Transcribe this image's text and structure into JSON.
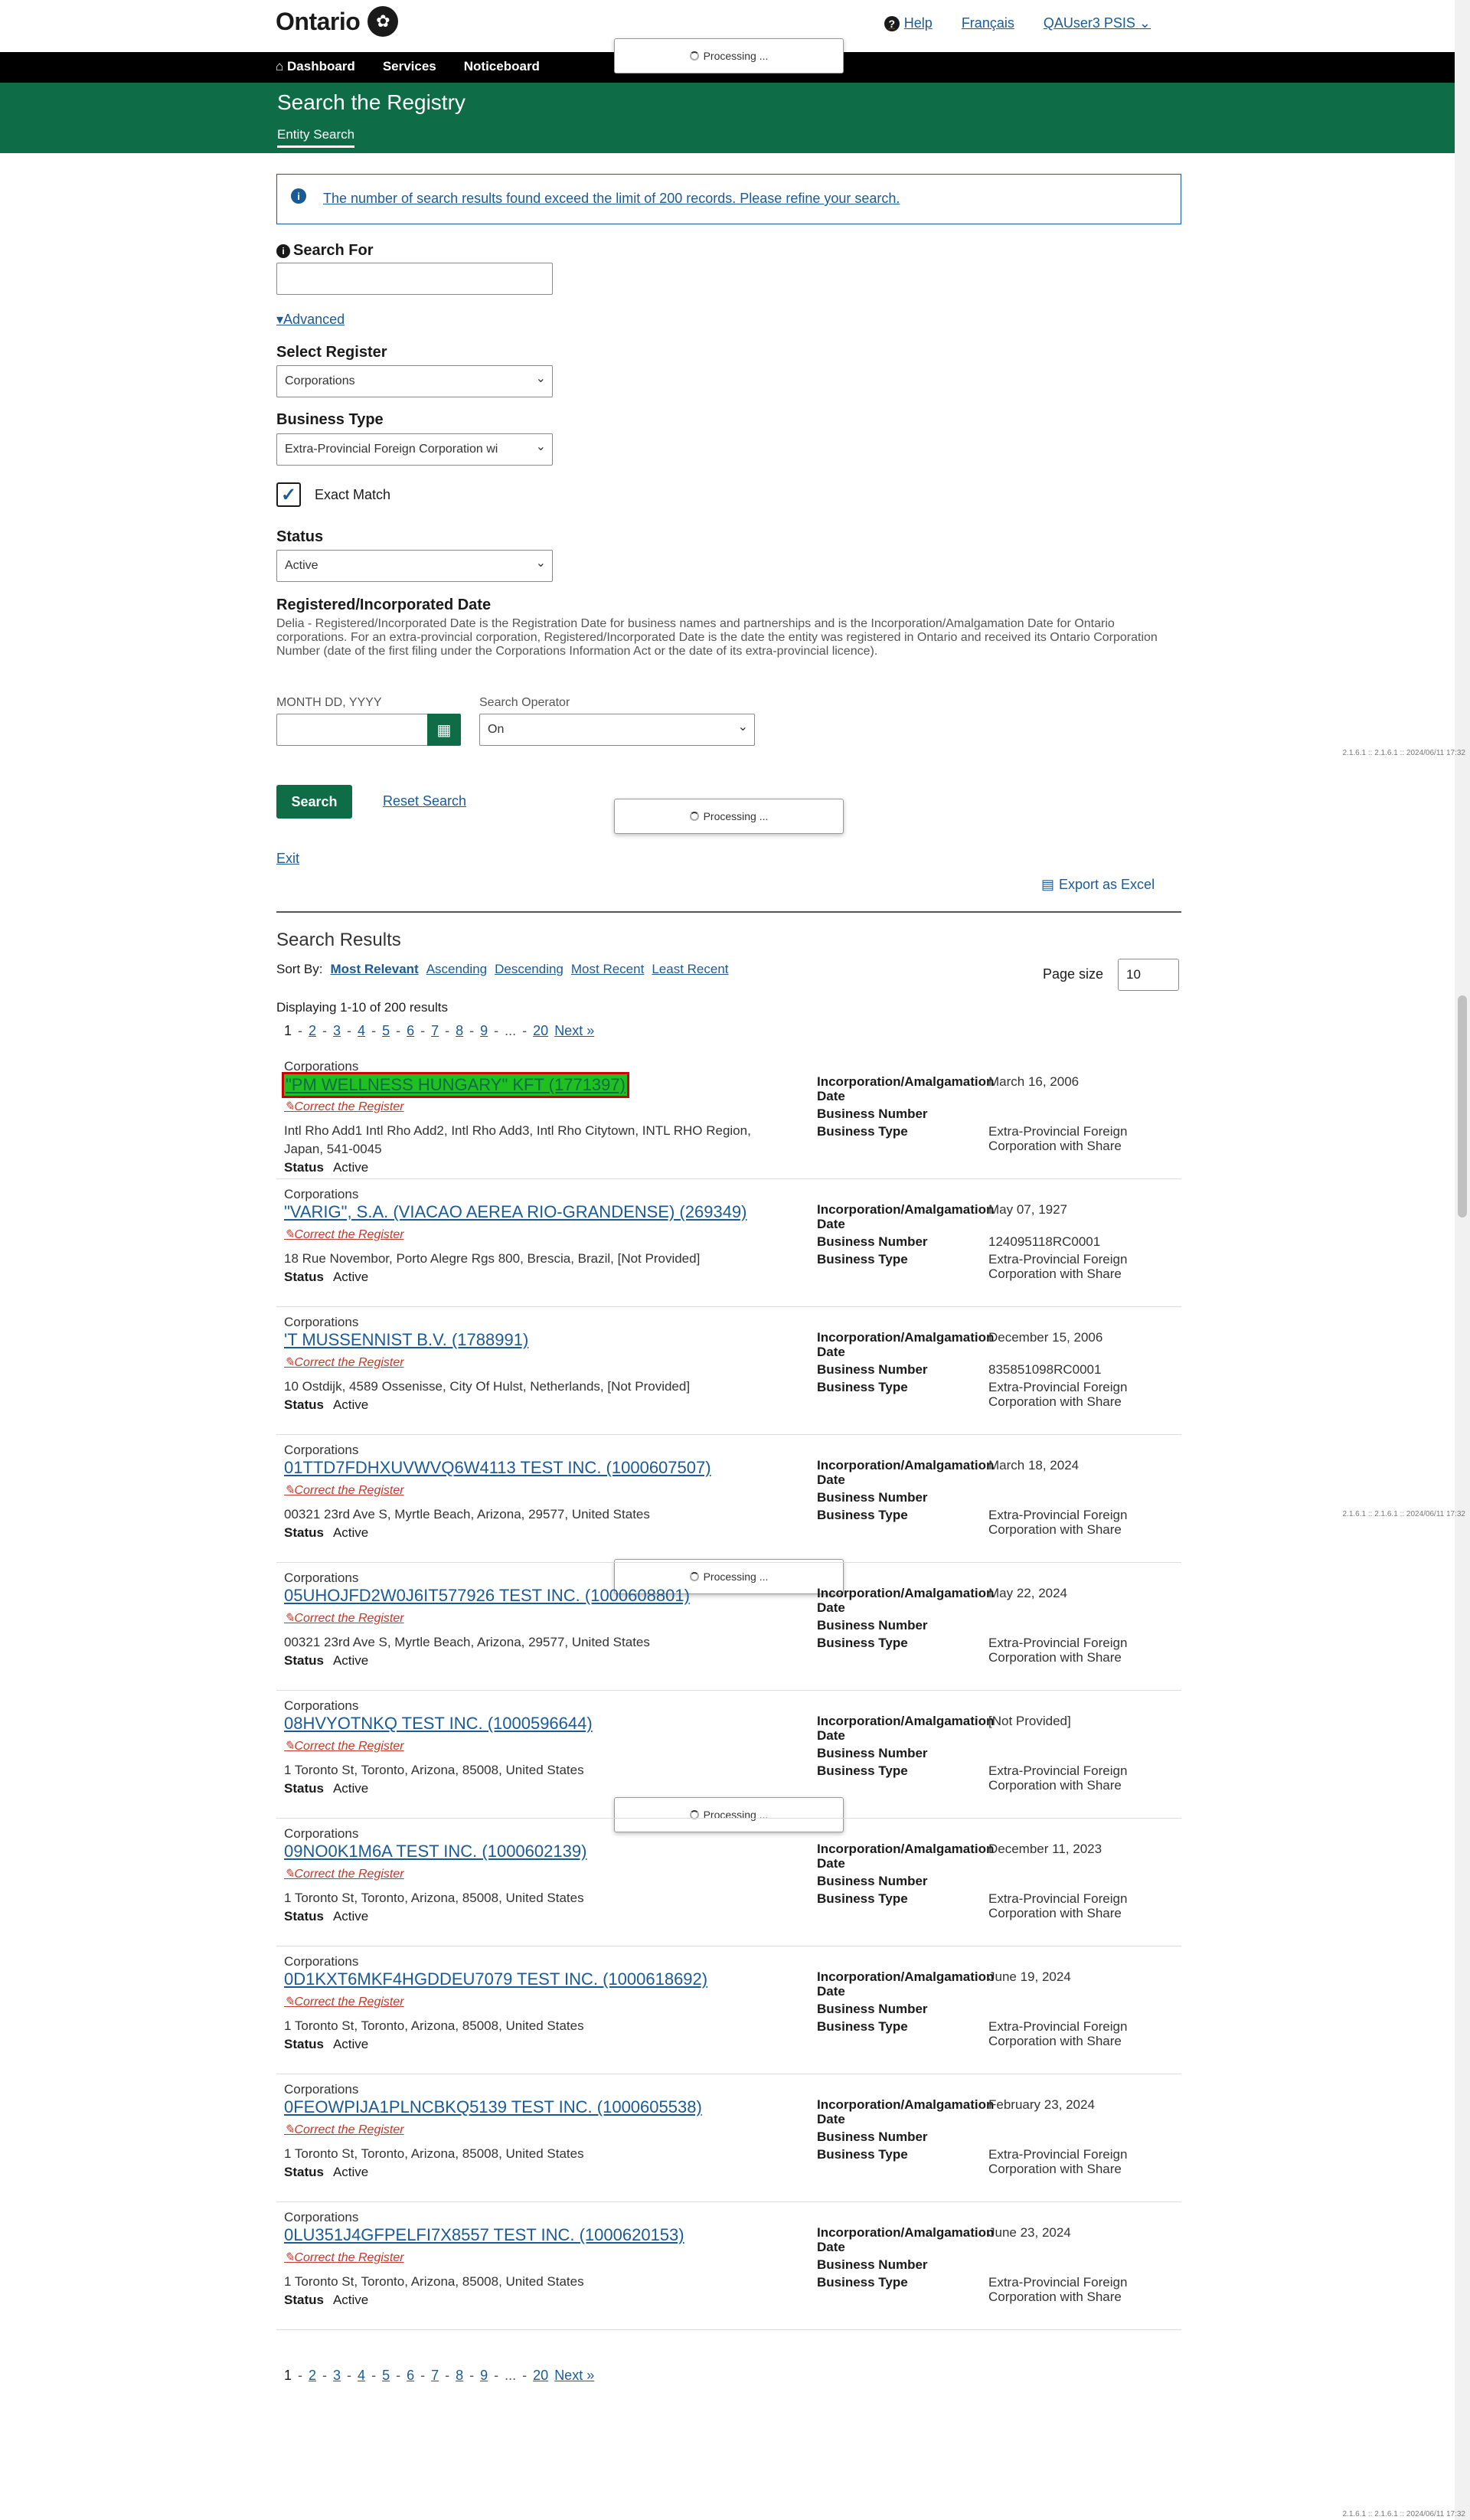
{
  "header": {
    "logo_text": "Ontario",
    "help": "Help",
    "language": "Français",
    "user": "QAUser3 PSIS"
  },
  "nav": {
    "dashboard": "Dashboard",
    "services": "Services",
    "noticeboard": "Noticeboard"
  },
  "page": {
    "title": "Search the Registry",
    "subtab": "Entity Search"
  },
  "processing_text": "Processing ...",
  "version_note": "2.1.6.1 :: 2.1.6.1 :: 2024/06/11 17:32",
  "alert": {
    "message": "The number of search results found exceed the limit of 200 records. Please refine your search."
  },
  "form": {
    "search_for_label": "Search For",
    "search_for_value": "",
    "advanced_link": "Advanced",
    "register_label": "Select Register",
    "register_value": "Corporations",
    "business_type_label": "Business Type",
    "business_type_value": "Extra-Provincial Foreign Corporation wi",
    "exact_match_label": "Exact Match",
    "exact_match_checked": true,
    "status_label": "Status",
    "status_value": "Active",
    "reg_date_label": "Registered/Incorporated Date",
    "reg_date_help": "Delia - Registered/Incorporated Date is the Registration Date for business names and partnerships and is the Incorporation/Amalgamation Date for Ontario corporations. For an extra-provincial corporation, Registered/Incorporated Date is the date the entity was registered in Ontario and received its Ontario Corporation Number (date of the first filing under the Corporations Information Act or the date of its extra-provincial licence).",
    "date_format_label": "MONTH DD, YYYY",
    "search_operator_label": "Search Operator",
    "search_operator_value": "On",
    "search_button": "Search",
    "reset_link": "Reset Search",
    "exit_link": "Exit",
    "export_button": "Export as Excel"
  },
  "results": {
    "title": "Search Results",
    "sort_by": "Sort By:",
    "sort_options": [
      "Most Relevant",
      "Ascending",
      "Descending",
      "Most Recent",
      "Least Recent"
    ],
    "page_size_label": "Page size",
    "page_size_value": "10",
    "displaying": "Displaying 1-10 of 200 results",
    "pager": {
      "current": "1",
      "pages": [
        "2",
        "3",
        "4",
        "5",
        "6",
        "7",
        "8",
        "9"
      ],
      "ellipsis": "...",
      "last": "20",
      "next": "Next »"
    },
    "meta_labels": {
      "incorporation": "Incorporation/Amalgamation Date",
      "business_number": "Business Number",
      "business_type": "Business Type"
    },
    "correct_label": "Correct the Register",
    "status_label": "Status",
    "items": [
      {
        "register": "Corporations",
        "name": "\"PM WELLNESS HUNGARY\" KFT (1771397)",
        "address": "Intl Rho Add1 Intl Rho Add2, Intl Rho Add3, Intl Rho Citytown, INTL RHO Region, Japan, 541-0045",
        "status": "Active",
        "date": "March 16, 2006",
        "business_number": "",
        "business_type": "Extra-Provincial Foreign Corporation with Share"
      },
      {
        "register": "Corporations",
        "name": "\"VARIG\", S.A. (VIACAO AEREA RIO-GRANDENSE) (269349)",
        "address": "18 Rue Novembor, Porto Alegre Rgs 800, Brescia, Brazil, [Not Provided]",
        "status": "Active",
        "date": "May 07, 1927",
        "business_number": "124095118RC0001",
        "business_type": "Extra-Provincial Foreign Corporation with Share"
      },
      {
        "register": "Corporations",
        "name": "'T MUSSENNIST B.V. (1788991)",
        "address": "10 Ostdijk, 4589 Ossenisse, City Of Hulst, Netherlands, [Not Provided]",
        "status": "Active",
        "date": "December 15, 2006",
        "business_number": "835851098RC0001",
        "business_type": "Extra-Provincial Foreign Corporation with Share"
      },
      {
        "register": "Corporations",
        "name": "01TTD7FDHXUVWVQ6W4113 TEST INC. (1000607507)",
        "address": "00321 23rd Ave S, Myrtle Beach, Arizona, 29577, United States",
        "status": "Active",
        "date": "March 18, 2024",
        "business_number": "",
        "business_type": "Extra-Provincial Foreign Corporation with Share"
      },
      {
        "register": "Corporations",
        "name": "05UHOJFD2W0J6IT577926 TEST INC. (1000608801)",
        "address": "00321 23rd Ave S, Myrtle Beach, Arizona, 29577, United States",
        "status": "Active",
        "date": "May 22, 2024",
        "business_number": "",
        "business_type": "Extra-Provincial Foreign Corporation with Share"
      },
      {
        "register": "Corporations",
        "name": "08HVYOTNKQ TEST INC. (1000596644)",
        "address": "1 Toronto St, Toronto, Arizona, 85008, United States",
        "status": "Active",
        "date": "[Not Provided]",
        "business_number": "",
        "business_type": "Extra-Provincial Foreign Corporation with Share"
      },
      {
        "register": "Corporations",
        "name": "09NO0K1M6A TEST INC. (1000602139)",
        "address": "1 Toronto St, Toronto, Arizona, 85008, United States",
        "status": "Active",
        "date": "December 11, 2023",
        "business_number": "",
        "business_type": "Extra-Provincial Foreign Corporation with Share"
      },
      {
        "register": "Corporations",
        "name": "0D1KXT6MKF4HGDDEU7079 TEST INC. (1000618692)",
        "address": "1 Toronto St, Toronto, Arizona, 85008, United States",
        "status": "Active",
        "date": "June 19, 2024",
        "business_number": "",
        "business_type": "Extra-Provincial Foreign Corporation with Share"
      },
      {
        "register": "Corporations",
        "name": "0FEOWPIJA1PLNCBKQ5139 TEST INC. (1000605538)",
        "address": "1 Toronto St, Toronto, Arizona, 85008, United States",
        "status": "Active",
        "date": "February 23, 2024",
        "business_number": "",
        "business_type": "Extra-Provincial Foreign Corporation with Share"
      },
      {
        "register": "Corporations",
        "name": "0LU351J4GFPELFI7X8557 TEST INC. (1000620153)",
        "address": "1 Toronto St, Toronto, Arizona, 85008, United States",
        "status": "Active",
        "date": "June 23, 2024",
        "business_number": "",
        "business_type": "Extra-Provincial Foreign Corporation with Share"
      }
    ]
  }
}
